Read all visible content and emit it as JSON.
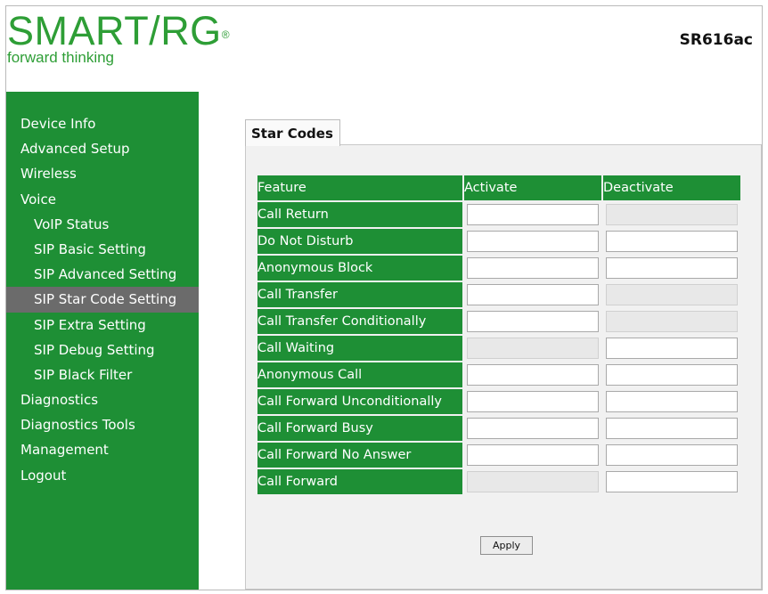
{
  "header": {
    "logo_text": "SMART/RG",
    "logo_reg": "®",
    "tagline": "forward thinking",
    "model": "SR616ac"
  },
  "sidebar": {
    "items": [
      {
        "label": "Device Info"
      },
      {
        "label": "Advanced Setup"
      },
      {
        "label": "Wireless"
      },
      {
        "label": "Voice"
      },
      {
        "label": "VoIP Status"
      },
      {
        "label": "SIP Basic Setting"
      },
      {
        "label": "SIP Advanced Setting"
      },
      {
        "label": "SIP Star Code Setting"
      },
      {
        "label": "SIP Extra Setting"
      },
      {
        "label": "SIP Debug Setting"
      },
      {
        "label": "SIP Black Filter"
      },
      {
        "label": "Diagnostics"
      },
      {
        "label": "Diagnostics Tools"
      },
      {
        "label": "Management"
      },
      {
        "label": "Logout"
      }
    ]
  },
  "main": {
    "tab_label": "Star Codes",
    "columns": [
      "Feature",
      "Activate",
      "Deactivate"
    ],
    "rows": [
      {
        "feature": "Call Return",
        "activate": "",
        "deactivate": ""
      },
      {
        "feature": "Do Not Disturb",
        "activate": "",
        "deactivate": ""
      },
      {
        "feature": "Anonymous Block",
        "activate": "",
        "deactivate": ""
      },
      {
        "feature": "Call Transfer",
        "activate": "",
        "deactivate": ""
      },
      {
        "feature": "Call Transfer Conditionally",
        "activate": "",
        "deactivate": ""
      },
      {
        "feature": "Call Waiting",
        "activate": "",
        "deactivate": ""
      },
      {
        "feature": "Anonymous Call",
        "activate": "",
        "deactivate": ""
      },
      {
        "feature": "Call Forward Unconditionally",
        "activate": "",
        "deactivate": ""
      },
      {
        "feature": "Call Forward Busy",
        "activate": "",
        "deactivate": ""
      },
      {
        "feature": "Call Forward No Answer",
        "activate": "",
        "deactivate": ""
      },
      {
        "feature": "Call Forward",
        "activate": "",
        "deactivate": ""
      }
    ],
    "apply_label": "Apply"
  },
  "colors": {
    "brand_green": "#1e8f35",
    "logo_green": "#2e9e36",
    "active_item": "#6b6b6b"
  }
}
